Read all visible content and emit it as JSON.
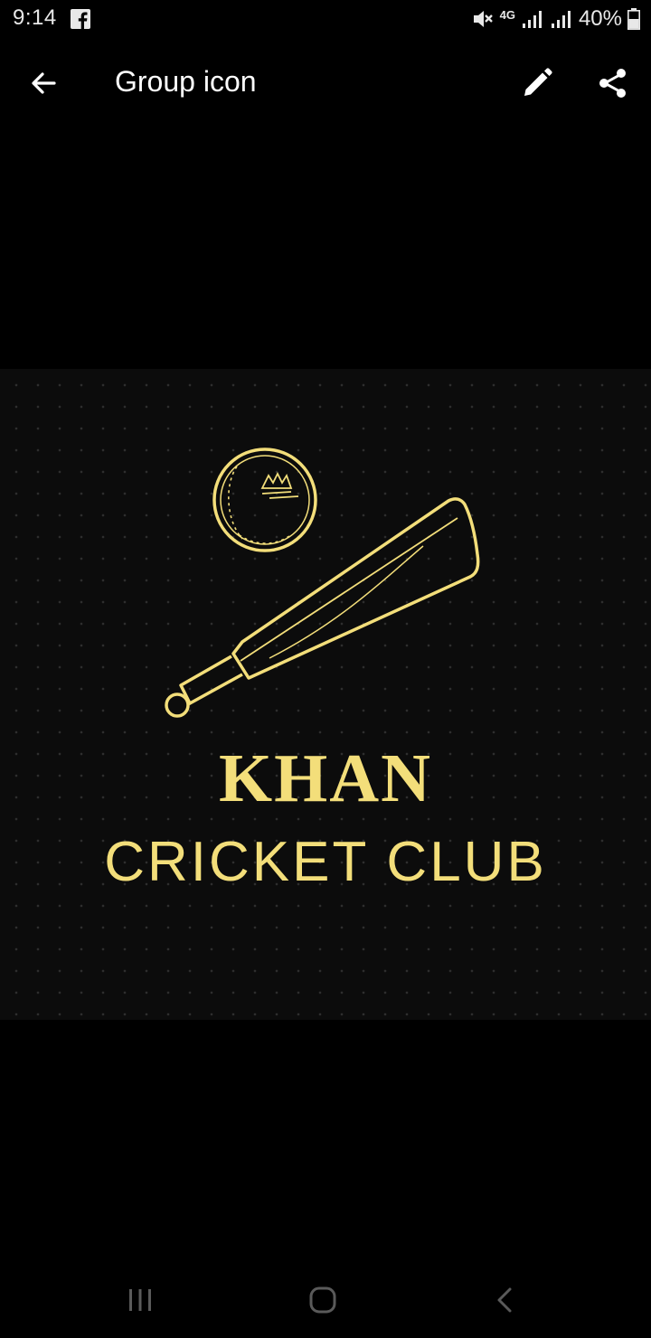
{
  "status_bar": {
    "time": "9:14",
    "network": "4G",
    "battery": "40%",
    "icons": [
      "facebook-icon",
      "mute-icon",
      "signal-icon",
      "battery-icon"
    ]
  },
  "app_bar": {
    "title": "Group icon",
    "icons": [
      "back-arrow-icon",
      "pencil-icon",
      "share-icon"
    ]
  },
  "group_image": {
    "title": "KHAN",
    "subtitle": "CRICKET CLUB",
    "accent_color": "#f3de7a",
    "background_color": "#0c0c0c"
  },
  "nav_bar": {
    "icons": [
      "recent-apps-icon",
      "home-icon",
      "back-icon"
    ]
  }
}
